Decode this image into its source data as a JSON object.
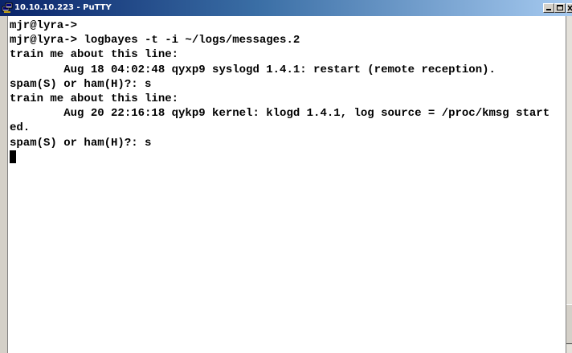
{
  "window": {
    "title": "10.10.10.223 - PuTTY",
    "icon": "putty-app-icon",
    "controls": [
      "minimize-icon",
      "maximize-icon",
      "close-icon"
    ]
  },
  "terminal": {
    "lines": [
      "mjr@lyra->",
      "mjr@lyra-> logbayes -t -i ~/logs/messages.2",
      "train me about this line:",
      "        Aug 18 04:02:48 qyxp9 syslogd 1.4.1: restart (remote reception).",
      "spam(S) or ham(H)?: s",
      "train me about this line:",
      "        Aug 20 22:16:18 qykp9 kernel: klogd 1.4.1, log source = /proc/kmsg start",
      "ed.",
      "spam(S) or ham(H)?: s"
    ]
  },
  "colors": {
    "title_gradient_start": "#0a246a",
    "title_gradient_end": "#a6caf0",
    "terminal_bg": "#ffffff",
    "terminal_fg": "#000000",
    "frame": "#d4d0c8"
  }
}
